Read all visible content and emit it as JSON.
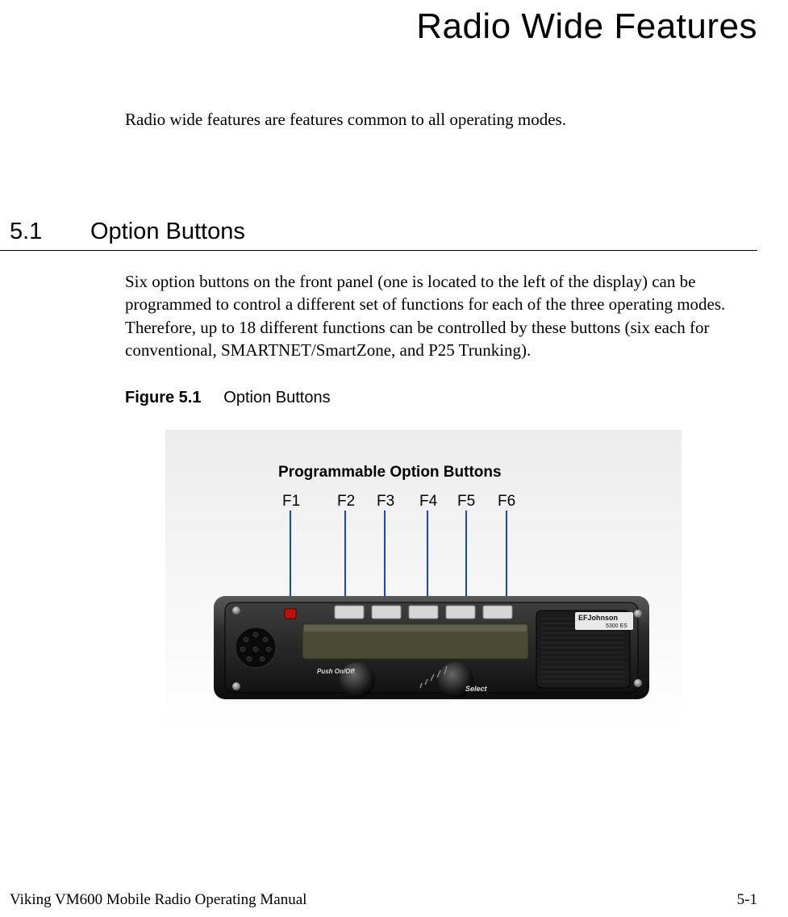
{
  "chapter_title": "Radio Wide Features",
  "intro": "Radio wide features are features common to all operating modes.",
  "section": {
    "num": "5.1",
    "title": "Option Buttons",
    "body": "Six option buttons on the front panel (one is located to the left of the display) can be programmed to control a different set of functions for each of the three operating modes. Therefore, up to 18 different functions can be controlled by these buttons (six each for conventional, SMARTNET/SmartZone, and P25 Trunking)."
  },
  "figure": {
    "label_num": "Figure 5.1",
    "label_title": "Option Buttons",
    "callout_title": "Programmable Option Buttons",
    "buttons": [
      "F1",
      "F2",
      "F3",
      "F4",
      "F5",
      "F6"
    ],
    "radio_brand": "EFJohnson",
    "radio_model": "5300 ES",
    "knob_left": "Push On/Off",
    "knob_right": "Select"
  },
  "footer": {
    "left": "Viking VM600 Mobile Radio Operating Manual",
    "right": "5-1"
  }
}
